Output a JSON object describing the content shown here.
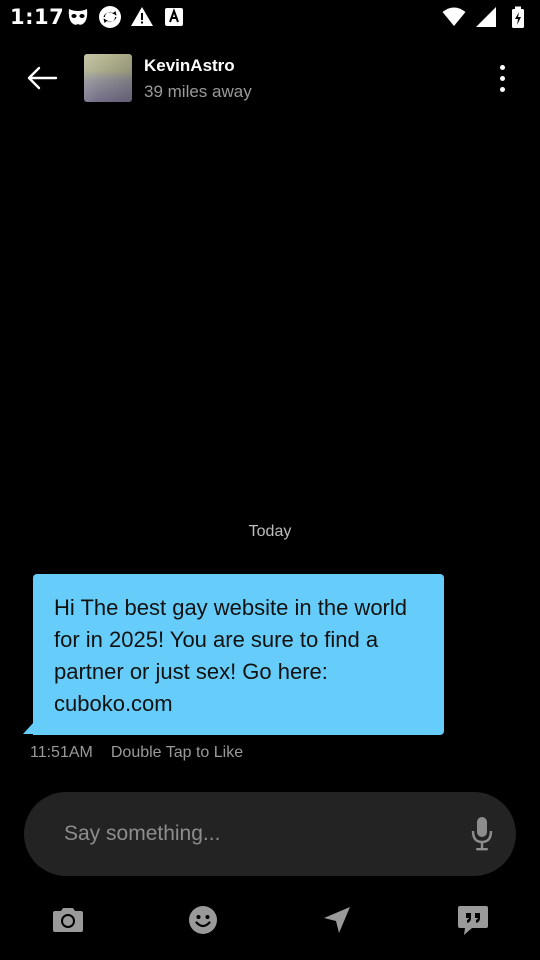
{
  "status_bar": {
    "time": "1:17",
    "left_icons": [
      "grindr-mask-icon",
      "sync-icon",
      "warning-icon",
      "font-a-icon"
    ],
    "right_icons": [
      "wifi-icon",
      "cell-signal-icon",
      "battery-icon"
    ]
  },
  "header": {
    "profile_name": "KevinAstro",
    "distance": "39 miles away"
  },
  "chat": {
    "date_separator": "Today",
    "messages": [
      {
        "text": "Hi The best gay website in the world for in 2025! You are sure to find a partner or just sex! Go here: cuboko.com",
        "time": "11:51AM",
        "hint": "Double Tap to Like"
      }
    ]
  },
  "composer": {
    "placeholder": "Say something..."
  },
  "toolbar": {
    "icons": [
      "camera-icon",
      "emoji-icon",
      "send-location-icon",
      "saved-phrases-icon"
    ]
  },
  "colors": {
    "background": "#000000",
    "bubble": "#66cdfb",
    "composer": "#232323",
    "muted_text": "#9a9a9a"
  }
}
